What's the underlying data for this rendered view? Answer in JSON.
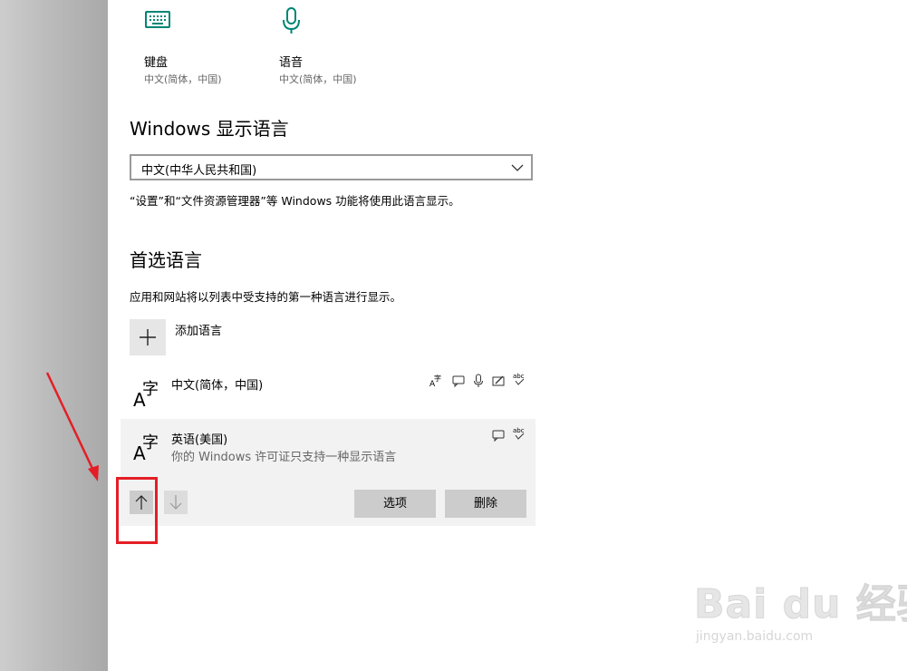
{
  "tiles": [
    {
      "title": "键盘",
      "subtitle": "中文(简体，中国)",
      "icon": "keyboard-icon"
    },
    {
      "title": "语音",
      "subtitle": "中文(简体，中国)",
      "icon": "microphone-icon"
    }
  ],
  "display_language": {
    "heading": "Windows 显示语言",
    "selected": "中文(中华人民共和国)",
    "note": "“设置”和“文件资源管理器”等 Windows 功能将使用此语言显示。"
  },
  "preferred": {
    "heading": "首选语言",
    "description": "应用和网站将以列表中受支持的第一种语言进行显示。",
    "add_label": "添加语言",
    "languages": [
      {
        "name": "中文(简体，中国)",
        "note": "",
        "features": [
          "display-language-icon",
          "text-to-speech-icon",
          "speech-recognition-icon",
          "handwriting-icon",
          "spell-check-icon"
        ]
      },
      {
        "name": "英语(美国)",
        "note": "你的 Windows 许可证只支持一种显示语言",
        "features": [
          "text-to-speech-icon",
          "spell-check-icon"
        ]
      }
    ],
    "options_label": "选项",
    "remove_label": "删除"
  },
  "glyph": {
    "a": "A",
    "zi": "字"
  },
  "watermark": {
    "big": "Bai du 经验",
    "small": "jingyan.baidu.com"
  },
  "colors": {
    "accent": "#008575",
    "annotation": "#e41e26"
  }
}
